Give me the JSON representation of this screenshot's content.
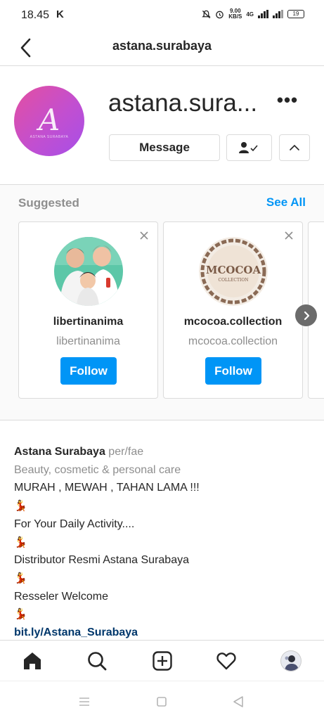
{
  "status_bar": {
    "time": "18.45",
    "k_icon": "K",
    "net_speed_value": "9.00",
    "net_speed_unit": "KB/S",
    "network": "4G",
    "battery": "19"
  },
  "header": {
    "title": "astana.surabaya",
    "back_icon": "chevron-left-icon"
  },
  "profile": {
    "display_name": "astana.sura...",
    "avatar_monogram": "A",
    "avatar_small_text": "ASTANA SURABAYA",
    "more_icon": "•••",
    "message_label": "Message",
    "follow_state_icon": "person-check-icon",
    "suggest_toggle_icon": "chevron-up-icon"
  },
  "suggested": {
    "title": "Suggested",
    "see_all": "See All",
    "cards": [
      {
        "name": "libertinanima",
        "handle": "libertinanima",
        "follow_label": "Follow"
      },
      {
        "name": "mcocoa.collection",
        "handle": "mcocoa.collection",
        "follow_label": "Follow",
        "logo_text": "MCOCOA",
        "logo_sub": "COLLECTION"
      }
    ]
  },
  "bio": {
    "name": "Astana Surabaya",
    "pronouns": "per/fae",
    "category": "Beauty, cosmetic & personal care",
    "lines": [
      "MURAH , MEWAH , TAHAN LAMA !!!",
      "💃",
      "For Your Daily Activity....",
      "💃",
      "Distributor Resmi Astana Surabaya",
      "💃",
      "Resseler Welcome",
      "💃"
    ],
    "link": "bit.ly/Astana_Surabaya"
  },
  "bottom_nav": {
    "items": [
      "home-icon",
      "search-icon",
      "add-post-icon",
      "activity-heart-icon",
      "profile-avatar"
    ]
  },
  "colors": {
    "accent": "#0095f6",
    "link": "#00376b",
    "muted": "#8e8e8e"
  }
}
